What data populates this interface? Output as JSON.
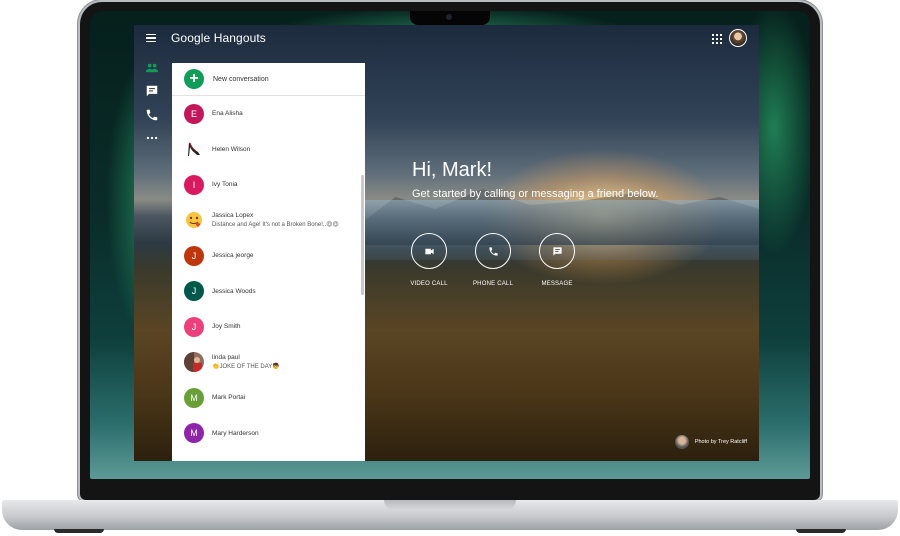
{
  "app": {
    "brand": "Google Hangouts"
  },
  "panel": {
    "new_conversation": "New conversation",
    "contacts": [
      {
        "initial": "E",
        "name": "Ena Alisha",
        "color": "#c2185b",
        "snippet": ""
      },
      {
        "initial": "",
        "name": "Helen Wilson",
        "color": "#ffffff",
        "snippet": "",
        "avatar": "high-heel-icon"
      },
      {
        "initial": "I",
        "name": "Ivy Tonia",
        "color": "#d81b60",
        "snippet": ""
      },
      {
        "initial": "",
        "name": "Jassica Lopex",
        "color": "#ffffff",
        "snippet": "Distance and Age! It's not a Broken Bone!..😍😍",
        "avatar": "heart-emoji-icon"
      },
      {
        "initial": "J",
        "name": "Jessica jeorge",
        "color": "#bf360c",
        "snippet": ""
      },
      {
        "initial": "J",
        "name": "Jessica Woods",
        "color": "#00584a",
        "snippet": ""
      },
      {
        "initial": "J",
        "name": "Joy Smith",
        "color": "#ec407a",
        "snippet": ""
      },
      {
        "initial": "",
        "name": "linda paul",
        "color": "#ffffff",
        "snippet": "👏JOKE OF THE DAY👦",
        "avatar": "photo-avatar-icon"
      },
      {
        "initial": "M",
        "name": "Mark Portai",
        "color": "#689f38",
        "snippet": ""
      },
      {
        "initial": "M",
        "name": "Mary Harderson",
        "color": "#8e24aa",
        "snippet": ""
      }
    ]
  },
  "main": {
    "greeting": "Hi, Mark!",
    "subtitle": "Get started by calling or messaging a friend below.",
    "actions": [
      {
        "label": "VIDEO CALL",
        "icon": "video-camera-icon"
      },
      {
        "label": "PHONE CALL",
        "icon": "phone-icon"
      },
      {
        "label": "MESSAGE",
        "icon": "message-icon"
      }
    ],
    "photo_credit": "Photo by Trey Ratcliff"
  },
  "colors": {
    "accent_green": "#0f9d58",
    "panel_bg": "#ffffff"
  }
}
